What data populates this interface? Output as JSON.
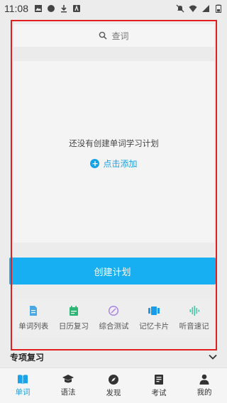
{
  "status": {
    "time": "11:08"
  },
  "search": {
    "placeholder": "查词"
  },
  "empty_state": {
    "message": "还没有创建单词学习计划",
    "add_label": "点击添加"
  },
  "create_button": {
    "label": "创建计划"
  },
  "tools": [
    {
      "label": "单词列表",
      "icon": "document-icon",
      "color": "#4aa8e6"
    },
    {
      "label": "日历复习",
      "icon": "calendar-icon",
      "color": "#2bb673"
    },
    {
      "label": "综合测试",
      "icon": "test-icon",
      "color": "#a884e8"
    },
    {
      "label": "记忆卡片",
      "icon": "cards-icon",
      "color": "#1a9be8"
    },
    {
      "label": "听音速记",
      "icon": "audio-wave-icon",
      "color": "#45c7a8"
    }
  ],
  "special_review": {
    "title": "专项复习"
  },
  "bottom_nav": [
    {
      "label": "单词",
      "icon": "book-icon",
      "active": true
    },
    {
      "label": "语法",
      "icon": "graduation-cap-icon",
      "active": false
    },
    {
      "label": "发现",
      "icon": "compass-icon",
      "active": false
    },
    {
      "label": "考试",
      "icon": "exam-paper-icon",
      "active": false
    },
    {
      "label": "我的",
      "icon": "person-icon",
      "active": false
    }
  ],
  "colors": {
    "accent": "#18aef2",
    "highlight_frame": "#e02020"
  }
}
